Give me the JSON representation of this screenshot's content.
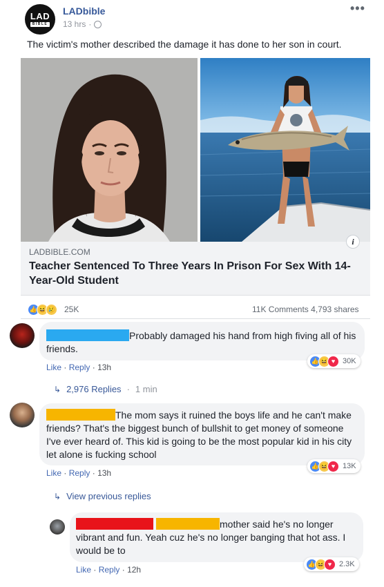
{
  "post": {
    "page_name": "LADbible",
    "avatar_line1": "LAD",
    "avatar_line2": "BIBLE",
    "time": "13 hrs",
    "more_icon": "more-dots-icon",
    "caption": "The victim's mother described the damage it has done to her son in court."
  },
  "link": {
    "domain": "LADBIBLE.COM",
    "title": "Teacher Sentenced To Three Years In Prison For Sex With 14-Year-Old Student",
    "info_label": "i"
  },
  "stats": {
    "reactions": "25K",
    "comments": "11K Comments",
    "shares": "4,793 shares"
  },
  "comments": [
    {
      "text": "Probably damaged his hand from high fiving all of his friends.",
      "like": "Like",
      "reply": "Reply",
      "time": "13h",
      "reactions": "30K",
      "redaction_colors": [
        "#2aa9f0"
      ]
    },
    {
      "text": "The mom says it ruined the boys life and he can't make friends? That's the biggest bunch of bullshit to get money of someone I've ever heard of. This kid is going to be the most popular kid in his city let alone is fucking school",
      "like": "Like",
      "reply": "Reply",
      "time": "13h",
      "reactions": "13K",
      "redaction_colors": [
        "#f7b500"
      ]
    }
  ],
  "replies_link_1": {
    "count": "2,976 Replies",
    "time": "1 min"
  },
  "replies_link_2": {
    "label": "View previous replies"
  },
  "reply": {
    "text": "mother said he's no longer vibrant and fun. Yeah cuz he's no longer banging that hot ass. I would be to",
    "like": "Like",
    "reply": "Reply",
    "time": "12h",
    "reactions": "2.3K",
    "redaction_colors": [
      "#e8131a",
      "#f7b500"
    ]
  },
  "colors": {
    "link_blue": "#365899",
    "action_blue": "#4267b2",
    "bubble": "#f2f3f5"
  }
}
